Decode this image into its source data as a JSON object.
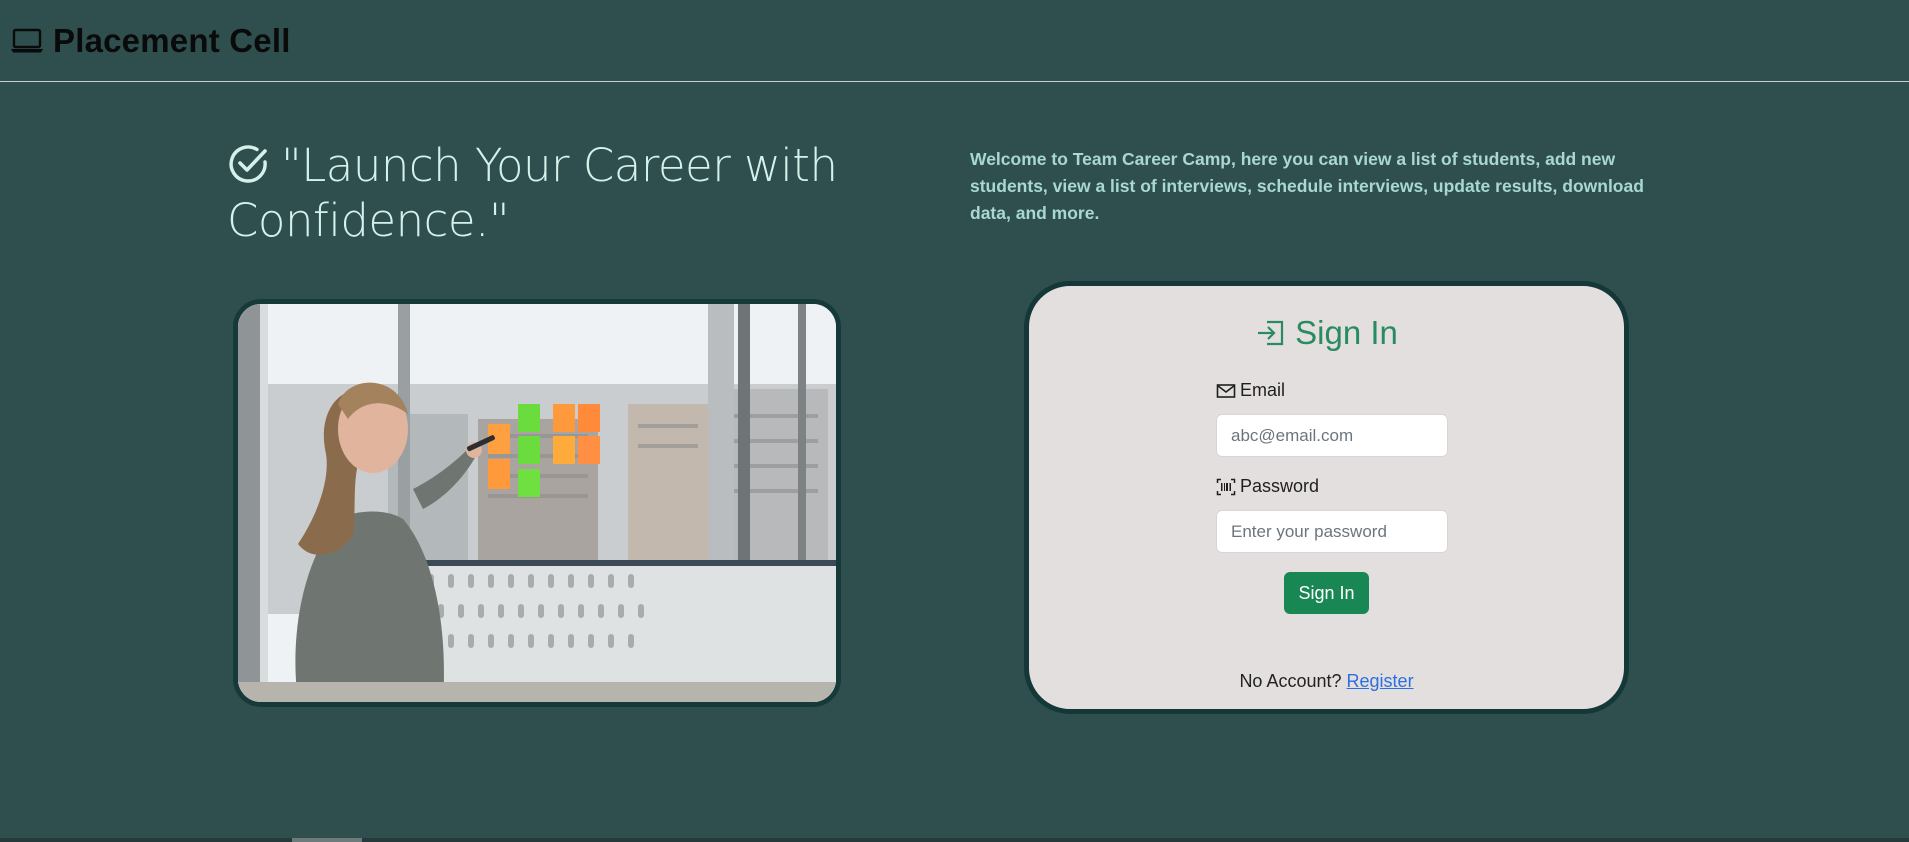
{
  "navbar": {
    "brand": "Placement Cell",
    "icon": "laptop-icon"
  },
  "hero": {
    "headline": "\"Launch Your Career with Confidence.\"",
    "headline_icon": "check-circle-icon",
    "welcome": "Welcome to Team Career Camp, here you can view a list of students, add new students, view a list of interviews, schedule interviews, update results, download data, and more."
  },
  "signin": {
    "title": "Sign In",
    "title_icon": "box-arrow-in-icon",
    "email_label": "Email",
    "email_icon": "envelope-icon",
    "email_placeholder": "abc@email.com",
    "password_label": "Password",
    "password_icon": "barcode-icon",
    "password_placeholder": "Enter your password",
    "submit_label": "Sign In",
    "no_account_text": "No Account?",
    "register_link": "Register"
  },
  "colors": {
    "background": "#2f4f4f",
    "accent": "#198754",
    "card": "#e4dfdf",
    "headline": "#d6f1ec",
    "welcome": "#a8d8d0"
  }
}
